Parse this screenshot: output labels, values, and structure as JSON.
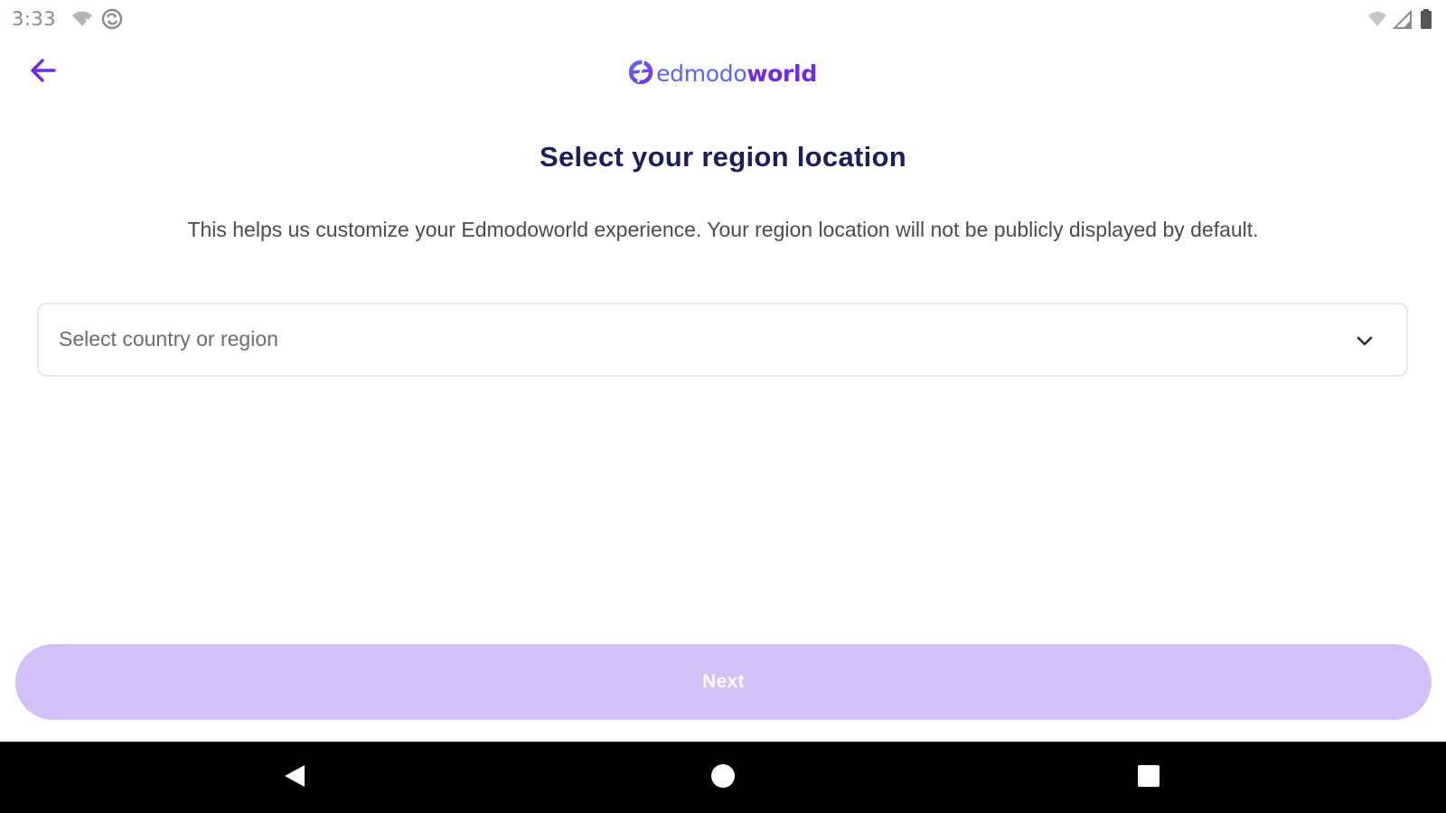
{
  "status_bar": {
    "time": "3:33",
    "icons": [
      "wifi-off-icon",
      "sync-icon",
      "wifi-icon",
      "cellular-signal-icon",
      "battery-icon"
    ]
  },
  "app_bar": {
    "back_icon": "arrow-left-icon",
    "logo": {
      "text_part1": "edmodo",
      "text_part2": "world",
      "colors": {
        "edmodo": "#5a63ff",
        "world": "#6f27e8"
      }
    }
  },
  "content": {
    "title": "Select your region location",
    "subtitle": "This helps us customize your Edmodoworld experience. Your region location will not be publicly displayed by default.",
    "region_select": {
      "placeholder": "Select country or region",
      "icon": "chevron-down-icon"
    }
  },
  "footer": {
    "next_label": "Next",
    "next_color": "#d3c0f8"
  },
  "nav_bar": {
    "icons": [
      "nav-back-icon",
      "nav-home-icon",
      "nav-recents-icon"
    ]
  },
  "colors": {
    "accent": "#6f27e8",
    "title": "#1c1d5e"
  }
}
